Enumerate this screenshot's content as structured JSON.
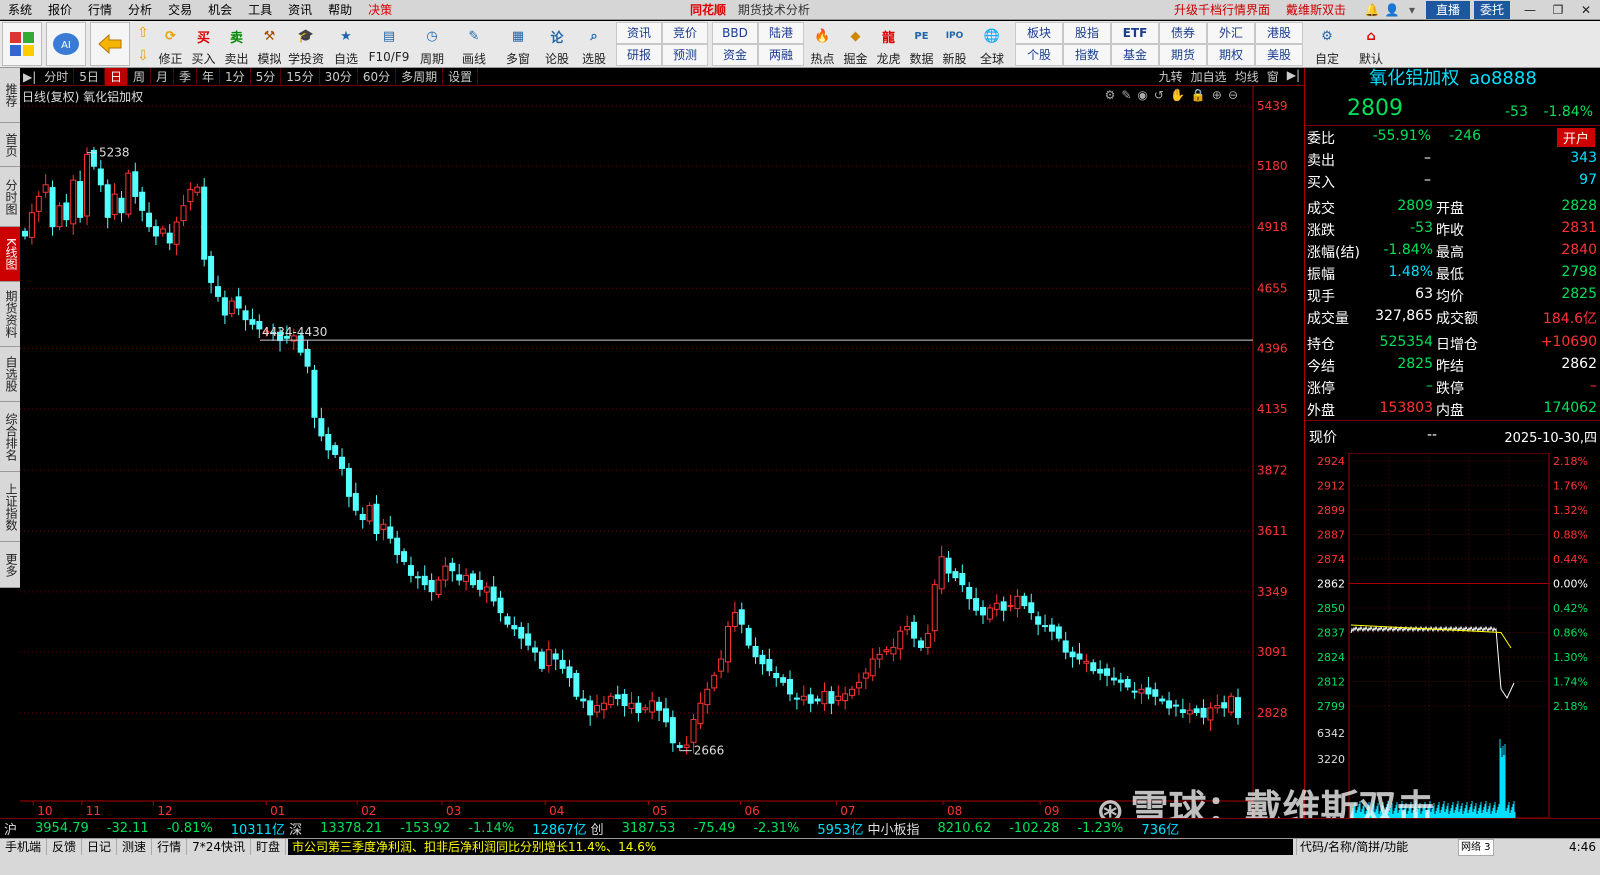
{
  "menu": {
    "items": [
      "系统",
      "报价",
      "行情",
      "分析",
      "交易",
      "机会",
      "工具",
      "资讯",
      "帮助",
      "决策"
    ],
    "logo": "同花顺",
    "title": "期货技术分析",
    "upgrade": "升级千档行情界面",
    "user": "戴维斯双击",
    "live": "直播",
    "acct": "委托"
  },
  "toolbar": {
    "buttons": [
      "修正",
      "买入",
      "卖出",
      "模拟",
      "学投资",
      "自选",
      "F10/F9",
      "周期",
      "画线",
      "多窗",
      "论股",
      "选股"
    ],
    "grid1": [
      "资讯",
      "竞价",
      "研报",
      "预测"
    ],
    "grid2": [
      "BBD",
      "陆港",
      "资金",
      "两融"
    ],
    "icons2": [
      "热点",
      "掘金",
      "龙虎",
      "数据",
      "新股",
      "全球"
    ],
    "grid3": [
      "板块",
      "股指",
      "ETF",
      "债券",
      "外汇",
      "港股",
      "个股",
      "指数",
      "基金",
      "期货",
      "期权",
      "美股"
    ],
    "right": [
      "自定",
      "默认"
    ]
  },
  "leftnav": [
    "推荐",
    "首页",
    "分时图",
    "K线图",
    "期货资料",
    "自选股",
    "综合排名",
    "上证指数",
    "更多"
  ],
  "periodbar": {
    "items": [
      "分时",
      "5日",
      "日",
      "周",
      "月",
      "季",
      "年",
      "1分",
      "5分",
      "15分",
      "30分",
      "60分",
      "多周期",
      "设置"
    ],
    "active": "日",
    "right": [
      "九转",
      "加自选",
      "均线",
      "窗"
    ]
  },
  "chart": {
    "header": "日线(复权) 氧化铝加权",
    "price_ticks": [
      "5439",
      "5180",
      "4918",
      "4655",
      "4396",
      "4135",
      "3872",
      "3611",
      "3349",
      "3091",
      "2828"
    ],
    "month_ticks": [
      "10",
      "11",
      "12",
      "01",
      "02",
      "03",
      "04",
      "05",
      "06",
      "07",
      "08",
      "09"
    ],
    "annot_high": "5238",
    "annot_low": "2666",
    "annot_line": "4434-4430",
    "watermark": "雪球：戴维斯双击"
  },
  "chart_data": {
    "type": "candlestick",
    "title": "日线(复权) 氧化铝加权",
    "ylim": [
      2666,
      5439
    ],
    "high_annotation": 5238,
    "low_annotation": 2666,
    "horizontal_line": 4432,
    "closes": [
      4880,
      4980,
      5050,
      5100,
      4920,
      5010,
      4950,
      5120,
      4960,
      5230,
      5180,
      5100,
      4960,
      5060,
      4980,
      5150,
      5050,
      4990,
      4920,
      4880,
      4910,
      4850,
      4940,
      5010,
      5080,
      5090,
      4780,
      4680,
      4620,
      4540,
      4600,
      4570,
      4520,
      4500,
      4480,
      4470,
      4460,
      4430,
      4440,
      4450,
      4380,
      4320,
      4100,
      4020,
      3960,
      3940,
      3880,
      3760,
      3700,
      3660,
      3720,
      3600,
      3640,
      3580,
      3510,
      3480,
      3420,
      3410,
      3380,
      3350,
      3400,
      3460,
      3440,
      3400,
      3420,
      3380,
      3360,
      3370,
      3310,
      3260,
      3210,
      3190,
      3150,
      3120,
      3090,
      3020,
      3100,
      3060,
      3020,
      2980,
      2900,
      2880,
      2820,
      2860,
      2870,
      2900,
      2890,
      2860,
      2870,
      2830,
      2850,
      2880,
      2840,
      2790,
      2700,
      2680,
      2690,
      2800,
      2870,
      2930,
      2990,
      3060,
      3200,
      3260,
      3210,
      3120,
      3070,
      3040,
      3010,
      2980,
      2960,
      2910,
      2890,
      2900,
      2870,
      2880,
      2920,
      2870,
      2900,
      2910,
      2930,
      2960,
      3000,
      3060,
      3080,
      3100,
      3110,
      3180,
      3200,
      3150,
      3110,
      3170,
      3380,
      3500,
      3430,
      3410,
      3380,
      3320,
      3270,
      3250,
      3280,
      3300,
      3270,
      3290,
      3330,
      3290,
      3260,
      3210,
      3200,
      3180,
      3150,
      3090,
      3070,
      3060,
      3050,
      3010,
      3000,
      2990,
      2970,
      2960,
      2940,
      2920,
      2930,
      2910,
      2900,
      2880,
      2850,
      2860,
      2830,
      2840,
      2830,
      2810,
      2850,
      2860,
      2850,
      2900,
      2809
    ]
  },
  "quote": {
    "name": "氧化铝加权",
    "code": "ao8888",
    "price": "2809",
    "change": "-53",
    "pct": "-1.84%",
    "rows": [
      [
        "委比",
        "-55.91%",
        "-246",
        "开户"
      ],
      [
        "卖出",
        "–",
        "343",
        ""
      ],
      [
        "买入",
        "–",
        "97",
        ""
      ],
      [
        "成交",
        "2809",
        "开盘",
        "2828"
      ],
      [
        "涨跌",
        "-53",
        "昨收",
        "2831"
      ],
      [
        "涨幅(结)",
        "-1.84%",
        "最高",
        "2840"
      ],
      [
        "振幅",
        "1.48%",
        "最低",
        "2798"
      ],
      [
        "现手",
        "63",
        "均价",
        "2825"
      ],
      [
        "成交量",
        "327,865",
        "成交额",
        "184.6亿"
      ],
      [
        "持仓",
        "525354",
        "日增仓",
        "+10690"
      ],
      [
        "今结",
        "2825",
        "昨结",
        "2862"
      ],
      [
        "涨停",
        "–",
        "跌停",
        "–"
      ],
      [
        "外盘",
        "153803",
        "内盘",
        "174062"
      ]
    ],
    "current_label": "现价",
    "current_val": "--",
    "date": "2025-10-30,四"
  },
  "intraday": {
    "prices": [
      "2924",
      "2912",
      "2899",
      "2887",
      "2874",
      "2862",
      "2850",
      "2837",
      "2824",
      "2812",
      "2799"
    ],
    "pcts": [
      "2.18%",
      "1.76%",
      "1.32%",
      "0.88%",
      "0.44%",
      "0.00%",
      "0.42%",
      "0.86%",
      "1.30%",
      "1.74%",
      "2.18%"
    ],
    "vols": [
      "6342",
      "3220"
    ]
  },
  "status": {
    "items": [
      [
        "沪",
        "3954.79",
        "-32.11",
        "-0.81%",
        "10311亿"
      ],
      [
        "深",
        "13378.21",
        "-153.92",
        "-1.14%",
        "12867亿"
      ],
      [
        "创",
        "3187.53",
        "-75.49",
        "-2.31%",
        "5953亿"
      ],
      [
        "中小板指",
        "8210.62",
        "-102.28",
        "-1.23%",
        "736亿"
      ]
    ]
  },
  "bottom": {
    "items": [
      "手机端",
      "反馈",
      "日记",
      "测速",
      "行情",
      "7*24快讯",
      "盯盘"
    ],
    "news": "市公司第三季度净利润、扣非后净利润同比分别增长11.4%、14.6%",
    "search": "代码/名称/简拼/功能",
    "net": "网络 3",
    "time": "4:46"
  }
}
